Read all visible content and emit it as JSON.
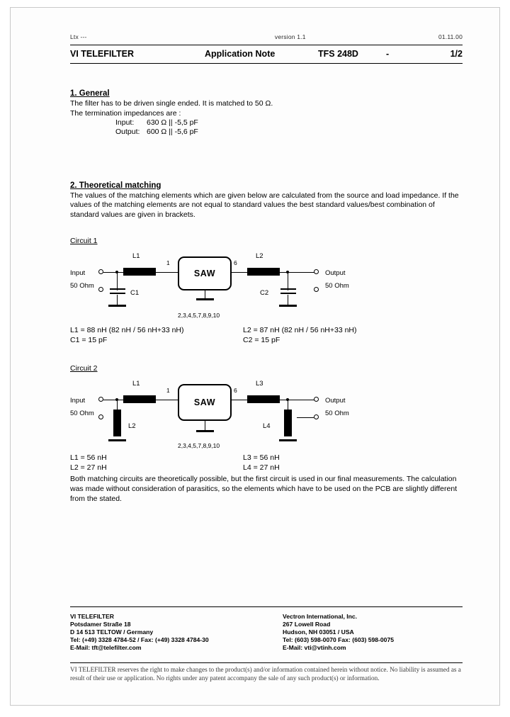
{
  "header": {
    "left_note": "Ltx ---",
    "version": "version 1.1",
    "date": "01.11.00",
    "company": "VI TELEFILTER",
    "doc_type": "Application Note",
    "part_number": "TFS 248D",
    "dash": "-",
    "page": "1/2"
  },
  "section1": {
    "heading": "1. General",
    "intro": "The filter has to be driven single ended. It is matched to 50 Ω.",
    "impedance_intro": "The termination impedances are :",
    "impedances": [
      {
        "label": "Input:",
        "value": "630 Ω || -5,5 pF"
      },
      {
        "label": "Output:",
        "value": "600 Ω || -5,6 pF"
      }
    ]
  },
  "section2": {
    "heading": "2. Theoretical matching",
    "paragraph": "The values of the matching elements which are given below are calculated from the source and load impedance. If the values of the matching elements are not equal to standard values the best standard values/best combination of standard values are given in brackets."
  },
  "circuit1": {
    "title": "Circuit 1",
    "input_label": "Input",
    "input_imp": "50 Ohm",
    "output_label": "Output",
    "output_imp": "50 Ohm",
    "device": "SAW",
    "pin_in": "1",
    "pin_out": "6",
    "ground_pins": "2,3,4,5,7,8,9,10",
    "l1_label": "L1",
    "l2_label": "L2",
    "c1_label": "C1",
    "c2_label": "C2",
    "values_left": [
      "L1 = 88 nH (82 nH / 56 nH+33 nH)",
      "C1 = 15 pF"
    ],
    "values_right": [
      "L2 = 87 nH (82 nH / 56 nH+33 nH)",
      "C2 = 15 pF"
    ]
  },
  "circuit2": {
    "title": "Circuit 2",
    "input_label": "Input",
    "input_imp": "50 Ohm",
    "output_label": "Output",
    "output_imp": "50 Ohm",
    "device": "SAW",
    "pin_in": "1",
    "pin_out": "6",
    "ground_pins": "2,3,4,5,7,8,9,10",
    "l1_label": "L1",
    "l2_label": "L2",
    "l3_label": "L3",
    "l4_label": "L4",
    "values_left": [
      "L1 = 56 nH",
      "L2 = 27 nH"
    ],
    "values_right": [
      "L3 = 56 nH",
      "L4 = 27 nH"
    ]
  },
  "closing": "Both matching circuits are theoretically possible, but the first circuit is used in our final measurements. The calculation was made without consideration of parasitics, so the elements which have to be used on the PCB are slightly different from the stated.",
  "footer": {
    "left": [
      "VI TELEFILTER",
      "Potsdamer Straße 18",
      "D 14 513 TELTOW / Germany",
      "Tel: (+49) 3328 4784-52 / Fax: (+49) 3328 4784-30",
      "E-Mail: tft@telefilter.com"
    ],
    "right": [
      "Vectron International, Inc.",
      "267 Lowell Road",
      "Hudson, NH 03051 / USA",
      "Tel: (603) 598-0070 Fax: (603) 598-0075",
      "E-Mail: vti@vtinh.com"
    ]
  },
  "disclaimer": "VI TELEFILTER reserves the right to make changes to the product(s) and/or information contained herein without notice. No liability is assumed as a result of their use or application. No rights under any patent accompany the sale of any such product(s) or information."
}
